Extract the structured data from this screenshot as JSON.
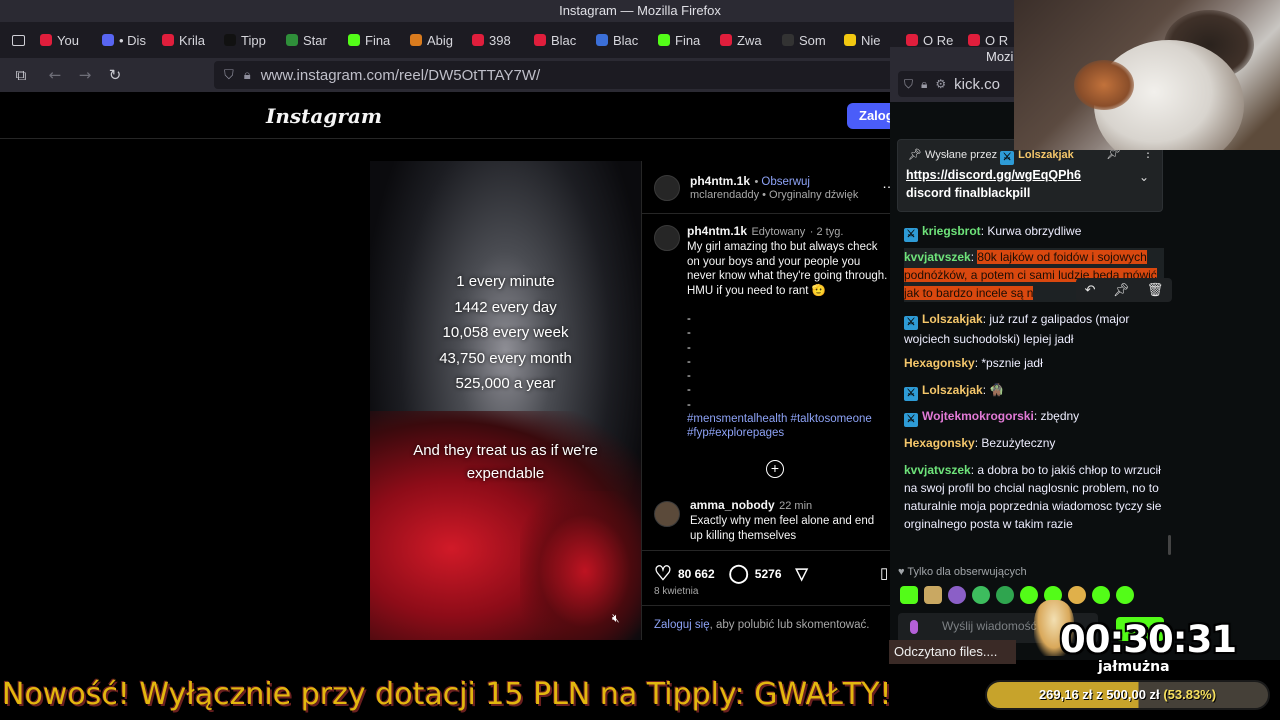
{
  "window": {
    "title": "Instagram — Mozilla Firefox"
  },
  "tabs": [
    {
      "label": "You",
      "color": "#e01e3c"
    },
    {
      "label": "• Dis",
      "color": "#5865f2"
    },
    {
      "label": "Krila",
      "color": "#e01e3c"
    },
    {
      "label": "Tipp",
      "color": "#111111"
    },
    {
      "label": "Star",
      "color": "#2f8f3a"
    },
    {
      "label": "Fina",
      "color": "#53fc18"
    },
    {
      "label": "Abig",
      "color": "#d97b1e"
    },
    {
      "label": "398",
      "color": "#e01e3c"
    },
    {
      "label": "Blac",
      "color": "#e01e3c"
    },
    {
      "label": "Blac",
      "color": "#3b6fd8"
    },
    {
      "label": "Fina",
      "color": "#53fc18"
    },
    {
      "label": "Zwa",
      "color": "#e01e3c"
    },
    {
      "label": "Som",
      "color": "#333333"
    },
    {
      "label": "Nie",
      "color": "#f2c811"
    },
    {
      "label": "O Re",
      "color": "#e01e3c"
    },
    {
      "label": "O R",
      "color": "#e01e3c"
    }
  ],
  "navbar": {
    "url": "www.instagram.com/reel/DW5OtTTAY7W/"
  },
  "instagram": {
    "logo": "Instagram",
    "login_button": "Zalog",
    "video": {
      "lines": [
        "1 every minute",
        "1442 every day",
        "10,058 every week",
        "43,750 every month",
        "525,000 a year"
      ],
      "lines2": [
        "And they treat us as if we're",
        "expendable"
      ]
    },
    "post": {
      "author": "ph4ntm.1k",
      "follow": "Obserwuj",
      "subline": "mclarendaddy • Oryginalny dźwięk",
      "caption_author": "ph4ntm.1k",
      "edited": "Edytowany",
      "age": "2 tyg.",
      "caption": "My girl amazing tho but always check on your boys and your people you never know what they're going through. HMU if you need to rant 🫡",
      "dashes": [
        "-",
        "-",
        "-",
        "-",
        "-",
        "-",
        "-"
      ],
      "hashtags1": "#mensmentalhealth #talktosomeone",
      "hashtags2": "#fyp#explorepages",
      "comment_author": "amma_nobody",
      "comment_age": "22 min",
      "comment_text": "Exactly why men feel alone and end up killing themselves",
      "likes": "80 662",
      "comments": "5276",
      "date": "8 kwietnia",
      "login_link": "Zaloguj się",
      "login_suffix": ", aby polubić lub skomentować."
    }
  },
  "kick": {
    "window_title": "Mozi",
    "url": "kick.co",
    "pinned": {
      "sent_by": "Wysłane przez",
      "user": "Lolszakjak",
      "link": "https://discord.gg/wgEqQPh6",
      "text": "discord finalblackpill"
    },
    "messages": [
      {
        "user": "kriegsbrot",
        "color": "#6ee37a",
        "badge": true,
        "text": "Kurwa obrzydliwe"
      },
      {
        "user": "kvvjatvszek",
        "color": "#6ee37a",
        "badge": false,
        "text": "80k lajków od foidów i sojowych podnóżków, a potem ci sami ludzie będą mówić jak to bardzo incele są n",
        "highlight": true
      },
      {
        "user": "Lolszakjak",
        "color": "#f5c76b",
        "badge": true,
        "text": "już rzuf z galipados (major wojciech suchodolski) lepiej jadł"
      },
      {
        "user": "Hexagonsky",
        "color": "#f5c76b",
        "badge": false,
        "text": "*psznie jadł"
      },
      {
        "user": "Lolszakjak",
        "color": "#f5c76b",
        "badge": true,
        "text": "🧌"
      },
      {
        "user": "Wojtekmokrogorski",
        "color": "#e27ad6",
        "badge": true,
        "text": "zbędny"
      },
      {
        "user": "Hexagonsky",
        "color": "#f5c76b",
        "badge": false,
        "text": "Bezużyteczny"
      },
      {
        "user": "kvvjatvszek",
        "color": "#6ee37a",
        "badge": false,
        "text": "a dobra bo to jakiś chłop to wrzucił na swoj profil bo chcial naglosnic problem, no to naturalnie moja poprzednia wiadomosc tyczy sie orginalnego posta w takim razie"
      }
    ],
    "followers_only": "Tylko dla obserwujących",
    "send_placeholder": "Wyślij wiadomość",
    "chat_button": "Chat"
  },
  "overlay": {
    "toast": "Odczytano files....",
    "timer": "00:30:31",
    "timer_label": "jałmużna",
    "ticker": "Nowość! Wyłącznie przy dotacji 15 PLN na Tipply: GWAŁTY!",
    "goal_current": "269,16 zł",
    "goal_of": "z",
    "goal_target": "500,00 zł",
    "goal_percent": "(53.83%)",
    "goal_fraction": 0.5383
  }
}
